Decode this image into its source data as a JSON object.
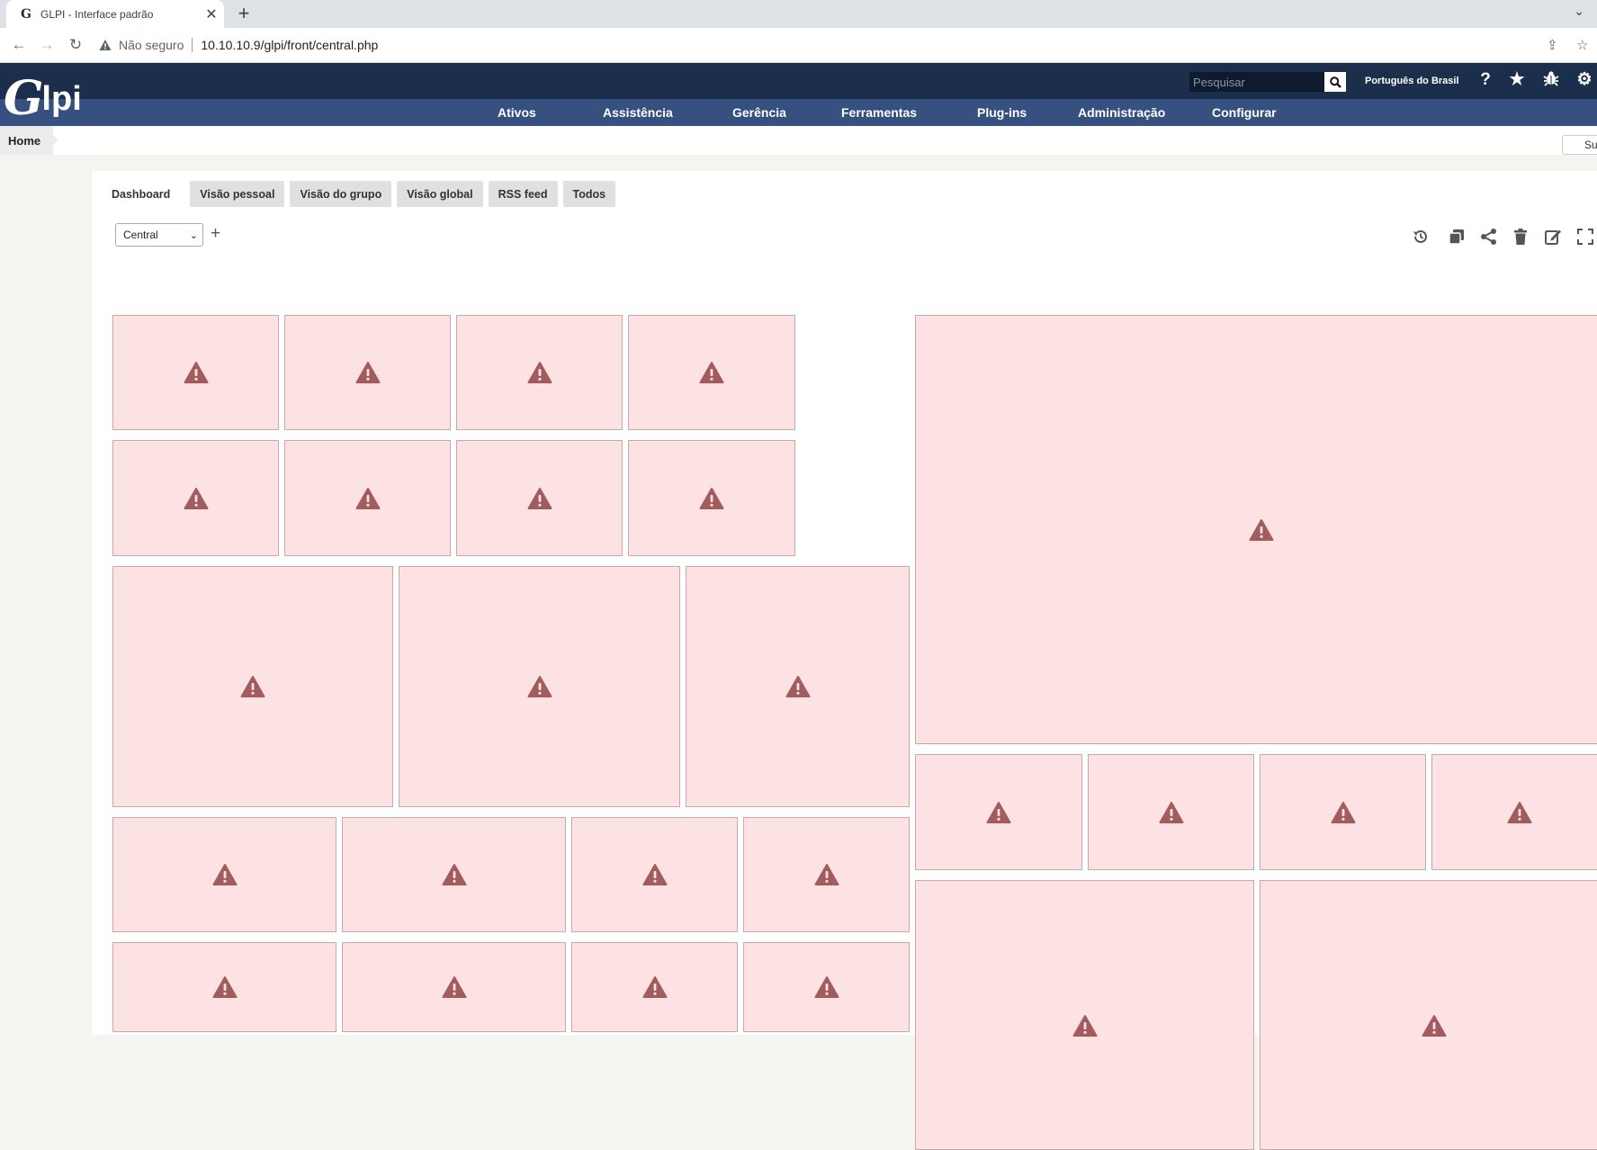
{
  "browser": {
    "tab_title": "GLPI - Interface padrão",
    "favicon": "G",
    "close_label": "✕",
    "new_tab_label": "+",
    "not_secure": "Não seguro",
    "url": "10.10.10.9/glpi/front/central.php"
  },
  "header": {
    "logo_g": "G",
    "logo_lpi": "lpi",
    "search_placeholder": "Pesquisar",
    "language": "Português do Brasil"
  },
  "menu": [
    "Ativos",
    "Assistência",
    "Gerência",
    "Ferramentas",
    "Plug-ins",
    "Administração",
    "Configurar"
  ],
  "breadcrumb": {
    "home": "Home",
    "right_button": "Su"
  },
  "tabs": [
    "Dashboard",
    "Visão pessoal",
    "Visão do grupo",
    "Visão global",
    "RSS feed",
    "Todos"
  ],
  "dashboard": {
    "selected": "Central",
    "add_label": "+"
  },
  "colors": {
    "header_dark": "#1b2e4b",
    "menu_blue": "#36507f",
    "card_bg": "#fde2e3",
    "warning_icon": "#a35c5e"
  }
}
